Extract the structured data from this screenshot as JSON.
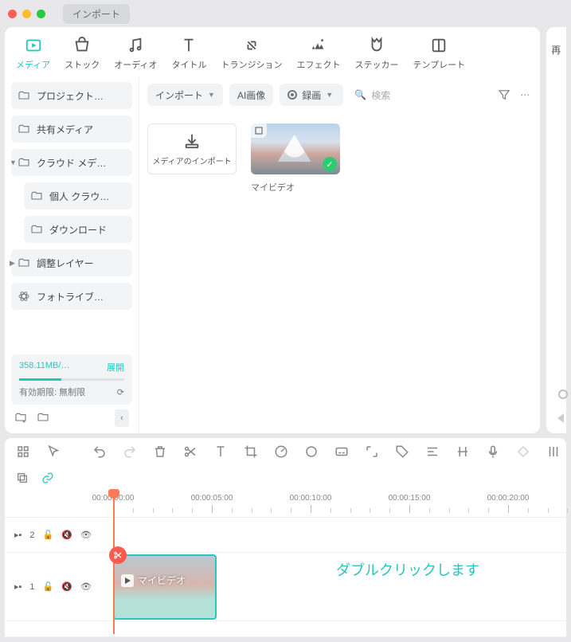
{
  "titlebar": {
    "import_btn": "インポート"
  },
  "tabs": [
    {
      "label": "メディア"
    },
    {
      "label": "ストック"
    },
    {
      "label": "オーディオ"
    },
    {
      "label": "タイトル"
    },
    {
      "label": "トランジション"
    },
    {
      "label": "エフェクト"
    },
    {
      "label": "ステッカー"
    },
    {
      "label": "テンプレート"
    }
  ],
  "side_sliver": {
    "label": "再"
  },
  "sidebar": {
    "items": [
      {
        "label": "プロジェクト…"
      },
      {
        "label": "共有メディア"
      },
      {
        "label": "クラウド メデ…"
      },
      {
        "label": "個人 クラウ…"
      },
      {
        "label": "ダウンロード"
      },
      {
        "label": "調整レイヤー"
      },
      {
        "label": "フォトライブ…"
      }
    ],
    "storage": {
      "size": "358.11MB/…",
      "expand": "展開",
      "expiry": "有効期限: 無制限"
    }
  },
  "toolbar": {
    "import": "インポート",
    "ai_image": "AI画像",
    "record": "録画",
    "search_placeholder": "検索"
  },
  "media_grid": {
    "import_card": "メディアのインポート",
    "video_card": "マイビデオ"
  },
  "timeline": {
    "ticks": [
      "00:00:00:00",
      "00:00:05:00",
      "00:00:10:00",
      "00:00:15:00",
      "00:00:20:00"
    ],
    "tracks": [
      {
        "kind": "video",
        "num": "2"
      },
      {
        "kind": "video",
        "num": "1"
      }
    ],
    "clip_label": "マイビデオ",
    "annotation": "ダブルクリックします"
  }
}
